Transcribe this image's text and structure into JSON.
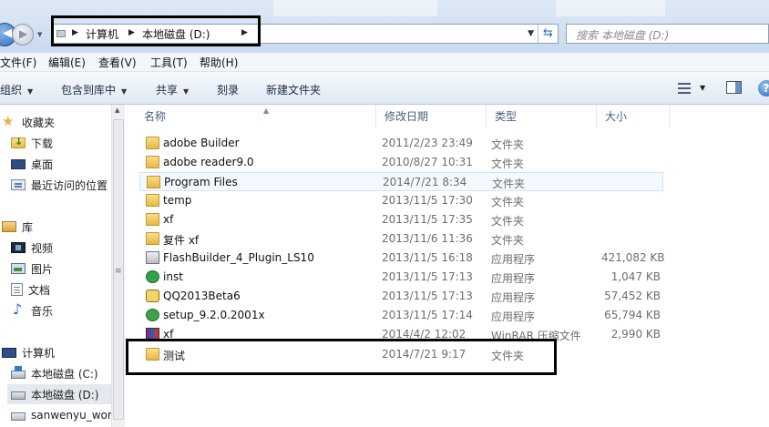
{
  "address": {
    "crumbs": [
      "计算机",
      "本地磁盘 (D:)"
    ],
    "search_placeholder": "搜索 本地磁盘 (D:)"
  },
  "menu": [
    "文件(F)",
    "编辑(E)",
    "查看(V)",
    "工具(T)",
    "帮助(H)"
  ],
  "toolbar": {
    "organize": "组织",
    "include_library": "包含到库中",
    "share": "共享",
    "burn": "刻录",
    "new_folder": "新建文件夹"
  },
  "nav": {
    "favorites": "收藏夹",
    "downloads": "下载",
    "desktop": "桌面",
    "recent": "最近访问的位置",
    "libraries": "库",
    "videos": "视频",
    "pictures": "图片",
    "documents": "文档",
    "music": "音乐",
    "computer": "计算机",
    "drive_c": "本地磁盘 (C:)",
    "drive_d": "本地磁盘 (D:)",
    "network_drive": "sanwenyu_work"
  },
  "columns": {
    "name": "名称",
    "modified": "修改日期",
    "type": "类型",
    "size": "大小"
  },
  "files": [
    {
      "name": "adobe Builder",
      "modified": "2011/2/23 23:49",
      "type": "文件夹",
      "size": "",
      "icon": "folder-icon"
    },
    {
      "name": "adobe reader9.0",
      "modified": "2010/8/27 10:31",
      "type": "文件夹",
      "size": "",
      "icon": "folder-icon"
    },
    {
      "name": "Program Files",
      "modified": "2014/7/21 8:34",
      "type": "文件夹",
      "size": "",
      "icon": "folder-icon"
    },
    {
      "name": "temp",
      "modified": "2013/11/5 17:30",
      "type": "文件夹",
      "size": "",
      "icon": "folder-icon"
    },
    {
      "name": "xf",
      "modified": "2013/11/5 17:35",
      "type": "文件夹",
      "size": "",
      "icon": "folder-icon"
    },
    {
      "name": "复件 xf",
      "modified": "2013/11/6 11:36",
      "type": "文件夹",
      "size": "",
      "icon": "folder-icon"
    },
    {
      "name": "FlashBuilder_4_Plugin_LS10",
      "modified": "2013/11/5 16:18",
      "type": "应用程序",
      "size": "421,082 KB",
      "icon": "installer-icon"
    },
    {
      "name": "inst",
      "modified": "2013/11/5 17:13",
      "type": "应用程序",
      "size": "1,047 KB",
      "icon": "app-icon"
    },
    {
      "name": "QQ2013Beta6",
      "modified": "2013/11/5 17:13",
      "type": "应用程序",
      "size": "57,452 KB",
      "icon": "qq-icon"
    },
    {
      "name": "setup_9.2.0.2001x",
      "modified": "2013/11/5 17:14",
      "type": "应用程序",
      "size": "65,794 KB",
      "icon": "setup-icon"
    },
    {
      "name": "xf",
      "modified": "2014/4/2 12:02",
      "type": "WinRAR 压缩文件",
      "size": "2,990 KB",
      "icon": "winrar-icon"
    },
    {
      "name": "测试",
      "modified": "2014/7/21 9:17",
      "type": "文件夹",
      "size": "",
      "icon": "folder-icon"
    }
  ]
}
